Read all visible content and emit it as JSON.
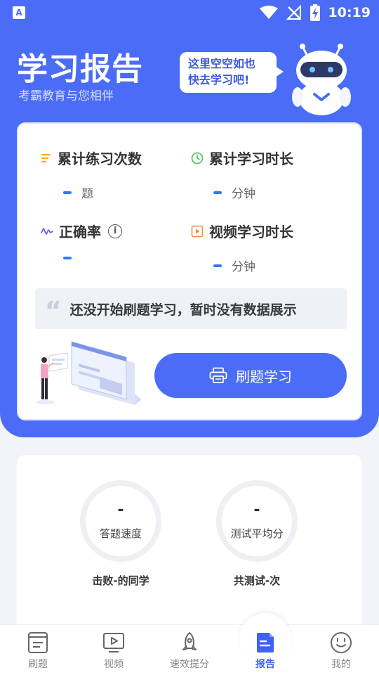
{
  "status_bar": {
    "time": "10:19",
    "app_icon": "A"
  },
  "header": {
    "title": "学习报告",
    "subtitle": "考霸教育与您相伴",
    "bubble_line1": "这里空空如也",
    "bubble_line2": "快去学习吧!"
  },
  "stats": {
    "practice_count": {
      "label": "累计练习次数",
      "value": "—",
      "unit": "题",
      "icon": "list-icon"
    },
    "study_time": {
      "label": "累计学习时长",
      "value": "—",
      "unit": "分钟",
      "icon": "clock-icon"
    },
    "accuracy": {
      "label": "正确率",
      "value": "—",
      "unit": "",
      "icon": "pulse-icon"
    },
    "video_time": {
      "label": "视频学习时长",
      "value": "—",
      "unit": "分钟",
      "icon": "video-icon"
    }
  },
  "notice": {
    "text": "还没开始刷题学习，暂时没有数据展示"
  },
  "action_button": {
    "label": "刷题学习"
  },
  "summary": {
    "speed": {
      "value": "-",
      "label": "答题速度",
      "footer": "击败-的同学"
    },
    "average": {
      "value": "-",
      "label": "测试平均分",
      "footer": "共测试-次"
    }
  },
  "tabs": [
    {
      "label": "刷题",
      "icon": "book-icon",
      "active": false
    },
    {
      "label": "视频",
      "icon": "tv-icon",
      "active": false
    },
    {
      "label": "速效提分",
      "icon": "rocket-icon",
      "active": false
    },
    {
      "label": "报告",
      "icon": "report-icon",
      "active": true
    },
    {
      "label": "我的",
      "icon": "smiley-icon",
      "active": false
    }
  ],
  "colors": {
    "primary": "#4a6cf7",
    "accent_blue": "#2f7cf6",
    "background": "#f2f4f8"
  }
}
